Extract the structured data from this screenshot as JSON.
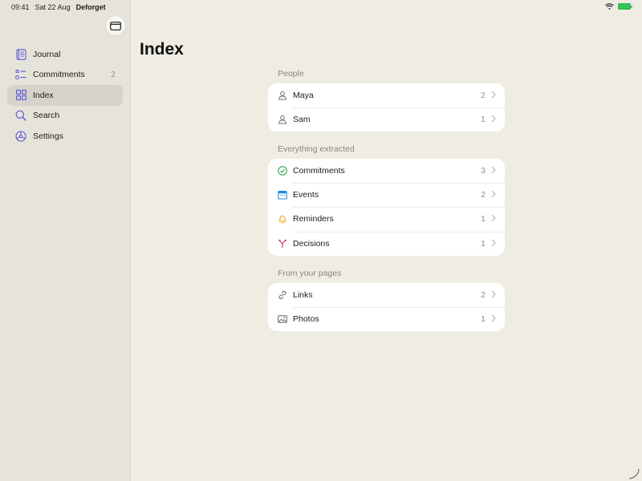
{
  "status": {
    "time": "09:41",
    "date": "Sat 22 Aug",
    "app": "Deforget"
  },
  "sidebar": {
    "items": [
      {
        "label": "Journal",
        "icon": "journal-icon",
        "count": ""
      },
      {
        "label": "Commitments",
        "icon": "checklist-icon",
        "count": "2"
      },
      {
        "label": "Index",
        "icon": "grid-icon",
        "count": ""
      },
      {
        "label": "Search",
        "icon": "search-icon",
        "count": ""
      },
      {
        "label": "Settings",
        "icon": "settings-icon",
        "count": ""
      }
    ],
    "active": "Index"
  },
  "main": {
    "title": "Index",
    "sections": [
      {
        "title": "People",
        "rows": [
          {
            "label": "Maya",
            "icon": "person-icon",
            "count": "2"
          },
          {
            "label": "Sam",
            "icon": "person-icon",
            "count": "1"
          }
        ]
      },
      {
        "title": "Everything extracted",
        "rows": [
          {
            "label": "Commitments",
            "icon": "checkmark-circle-icon",
            "count": "3"
          },
          {
            "label": "Events",
            "icon": "calendar-icon",
            "count": "2"
          },
          {
            "label": "Reminders",
            "icon": "bell-icon",
            "count": "1"
          },
          {
            "label": "Decisions",
            "icon": "branch-icon",
            "count": "1"
          }
        ]
      },
      {
        "title": "From your pages",
        "rows": [
          {
            "label": "Links",
            "icon": "link-icon",
            "count": "2"
          },
          {
            "label": "Photos",
            "icon": "photo-icon",
            "count": "1"
          }
        ]
      }
    ]
  },
  "colors": {
    "accent": "#5856d6",
    "active_bg": "#d5d3ca",
    "check_green": "#34a853",
    "calendar_blue": "#1e88e5",
    "bell_orange": "#f5a623",
    "decision_pink": "#d63a6e",
    "battery_green": "#34c759"
  }
}
